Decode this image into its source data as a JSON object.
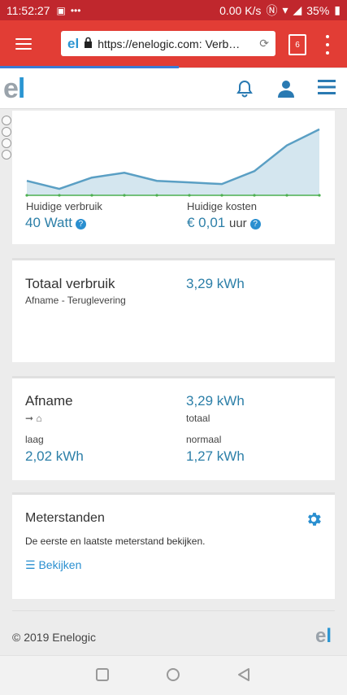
{
  "status": {
    "time": "11:52:27",
    "speed": "0.00 K/s",
    "battery": "35%"
  },
  "browser": {
    "url": "https://enelogic.com: Verb…",
    "tab_count": "6",
    "site_mini_logo": "el"
  },
  "app": {
    "logo_e": "e",
    "logo_l": "l"
  },
  "chart": {
    "current_usage_label": "Huidige verbruik",
    "current_usage_value": "40 Watt",
    "current_cost_label": "Huidige kosten",
    "current_cost_value": "€ 0,01",
    "current_cost_unit": "uur"
  },
  "chart_data": {
    "type": "area",
    "values": [
      18,
      8,
      22,
      28,
      18,
      16,
      14,
      30,
      62,
      82
    ],
    "ylim": [
      0,
      90
    ],
    "series_color": "#5a9fc4",
    "fill_color": "#d4e6ef",
    "baseline_color": "#4caf50"
  },
  "total": {
    "title": "Totaal verbruik",
    "value": "3,29 kWh",
    "subtitle": "Afname - Teruglevering"
  },
  "afname": {
    "title": "Afname",
    "total_value": "3,29 kWh",
    "total_label": "totaal",
    "low_label": "laag",
    "low_value": "2,02 kWh",
    "normal_label": "normaal",
    "normal_value": "1,27 kWh"
  },
  "meters": {
    "title": "Meterstanden",
    "description": "De eerste en laatste meterstand bekijken.",
    "link_label": "Bekijken"
  },
  "footer": {
    "copyright": "© 2019 Enelogic"
  }
}
